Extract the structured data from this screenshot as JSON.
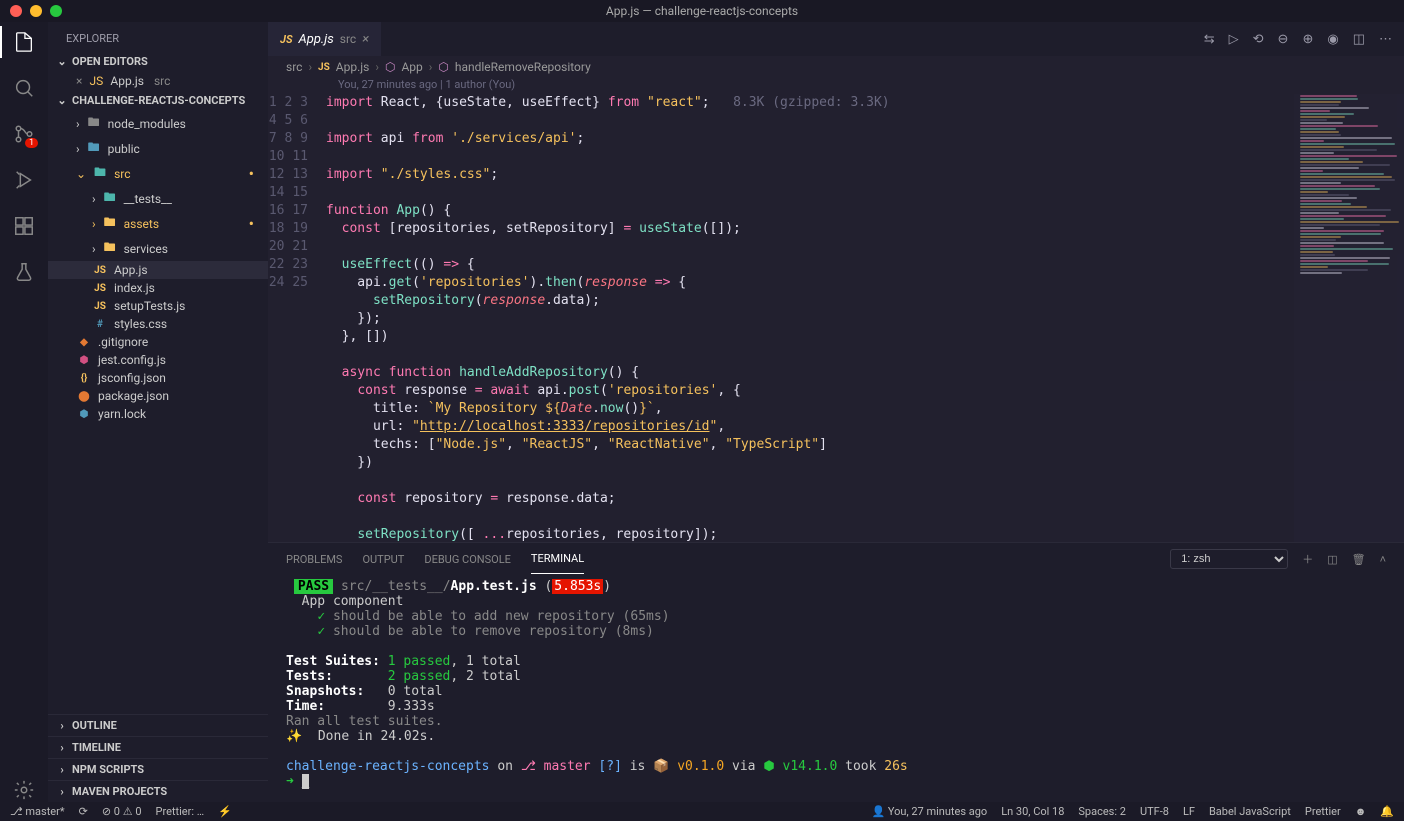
{
  "title": "App.js — challenge-reactjs-concepts",
  "explorer_label": "EXPLORER",
  "open_editors_label": "OPEN EDITORS",
  "open_editor": {
    "name": "App.js",
    "dir": "src"
  },
  "project_name": "CHALLENGE-REACTJS-CONCEPTS",
  "tree": [
    {
      "kind": "folder",
      "name": "node_modules",
      "depth": 1,
      "open": false,
      "iconColor": "gray"
    },
    {
      "kind": "folder",
      "name": "public",
      "depth": 1,
      "open": false,
      "iconColor": "blue"
    },
    {
      "kind": "folder",
      "name": "src",
      "depth": 1,
      "open": true,
      "iconColor": "teal",
      "modified": true
    },
    {
      "kind": "folder",
      "name": "__tests__",
      "depth": 2,
      "open": false,
      "iconColor": "teal"
    },
    {
      "kind": "folder",
      "name": "assets",
      "depth": 2,
      "open": false,
      "iconColor": "yellow",
      "modified": true
    },
    {
      "kind": "folder",
      "name": "services",
      "depth": 2,
      "open": false,
      "iconColor": "yellow"
    },
    {
      "kind": "file",
      "name": "App.js",
      "depth": 2,
      "icon": "js",
      "active": true
    },
    {
      "kind": "file",
      "name": "index.js",
      "depth": 2,
      "icon": "js"
    },
    {
      "kind": "file",
      "name": "setupTests.js",
      "depth": 2,
      "icon": "js"
    },
    {
      "kind": "file",
      "name": "styles.css",
      "depth": 2,
      "icon": "css"
    },
    {
      "kind": "file",
      "name": ".gitignore",
      "depth": 1,
      "icon": "git"
    },
    {
      "kind": "file",
      "name": "jest.config.js",
      "depth": 1,
      "icon": "jest"
    },
    {
      "kind": "file",
      "name": "jsconfig.json",
      "depth": 1,
      "icon": "json"
    },
    {
      "kind": "file",
      "name": "package.json",
      "depth": 1,
      "icon": "npm"
    },
    {
      "kind": "file",
      "name": "yarn.lock",
      "depth": 1,
      "icon": "yarn"
    }
  ],
  "bottom_sections": [
    "OUTLINE",
    "TIMELINE",
    "NPM SCRIPTS",
    "MAVEN PROJECTS"
  ],
  "tab": {
    "name": "App.js",
    "dir": "src"
  },
  "breadcrumb": [
    "src",
    "App.js",
    "App",
    "handleRemoveRepository"
  ],
  "codelens": "You, 27 minutes ago | 1 author (You)",
  "gzip_hint": "8.3K (gzipped: 3.3K)",
  "code_lines": [
    "import React, {useState, useEffect} from \"react\";",
    "",
    "import api from './services/api';",
    "",
    "import \"./styles.css\";",
    "",
    "function App() {",
    "  const [repositories, setRepository] = useState([]);",
    "",
    "  useEffect(() => {",
    "    api.get('repositories').then(response => {",
    "      setRepository(response.data);",
    "    });",
    "  }, [])",
    "",
    "  async function handleAddRepository() {",
    "    const response = await api.post('repositories', {",
    "      title: `My Repository ${Date.now()}`,",
    "      url: \"http://localhost:3333/repositories/id\",",
    "      techs: [\"Node.js\", \"ReactJS\", \"ReactNative\", \"TypeScript\"]",
    "    })",
    "",
    "    const repository = response.data;",
    "",
    "    setRepository([ ...repositories, repository]);"
  ],
  "panel_tabs": [
    "PROBLEMS",
    "OUTPUT",
    "DEBUG CONSOLE",
    "TERMINAL"
  ],
  "terminal_select": "1: zsh",
  "terminal": {
    "pass": "PASS",
    "path": "src/__tests__/",
    "file": "App.test.js",
    "time": "5.853s",
    "suite": "App component",
    "tests": [
      "should be able to add new repository (65ms)",
      "should be able to remove repository (8ms)"
    ],
    "summary": {
      "suites_label": "Test Suites:",
      "suites_pass": "1 passed",
      "suites_total": ", 1 total",
      "tests_label": "Tests:",
      "tests_pass": "2 passed",
      "tests_total": ", 2 total",
      "snap_label": "Snapshots:",
      "snap_val": "0 total",
      "time_label": "Time:",
      "time_val": "9.333s",
      "ran": "Ran all test suites.",
      "done": "✨  Done in 24.02s."
    },
    "prompt": {
      "project": "challenge-reactjs-concepts",
      "on": "on",
      "branch": "master",
      "dirty": "[?]",
      "is": "is",
      "pkgicon": "📦",
      "pkgver": "v0.1.0",
      "via": "via",
      "nodeicon": "⬢",
      "nodever": "v14.1.0",
      "took": "took",
      "dur": "26s"
    }
  },
  "status": {
    "branch": "master*",
    "errors": "0",
    "warnings": "0",
    "prettier": "Prettier: …",
    "blame": "You, 27 minutes ago",
    "pos": "Ln 30, Col 18",
    "spaces": "Spaces: 2",
    "enc": "UTF-8",
    "eol": "LF",
    "lang": "Babel JavaScript",
    "fmt": "Prettier"
  },
  "scm_badge": "1"
}
